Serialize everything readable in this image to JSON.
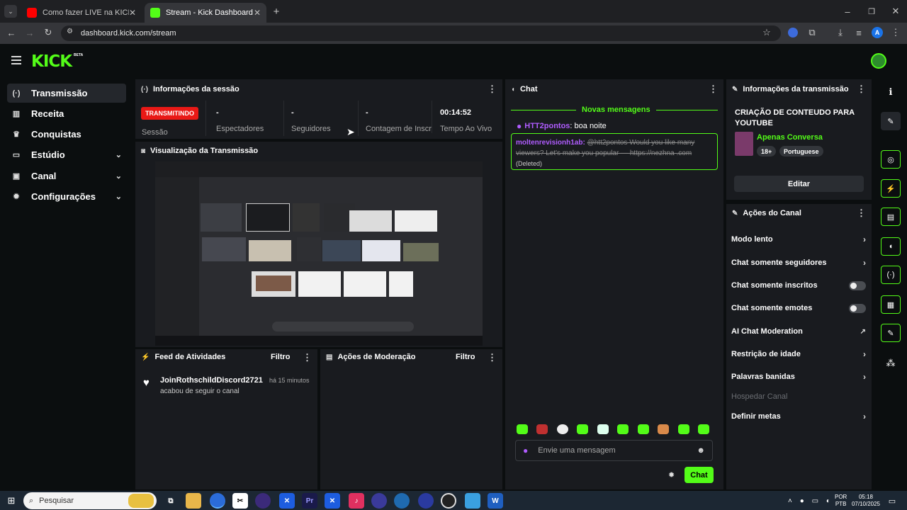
{
  "browser": {
    "tabs": [
      {
        "title": "Como fazer LIVE na KICK pelo C",
        "active": false
      },
      {
        "title": "Stream - Kick Dashboard",
        "active": true
      }
    ],
    "url": "dashboard.kick.com/stream",
    "profile_initial": "A"
  },
  "header": {
    "logo": "KICK",
    "beta": "BETA"
  },
  "sidebar": {
    "items": [
      {
        "label": "Transmissão",
        "icon": "broadcast-icon",
        "active": true
      },
      {
        "label": "Receita",
        "icon": "chart-icon"
      },
      {
        "label": "Conquistas",
        "icon": "trophy-icon"
      },
      {
        "label": "Estúdio",
        "icon": "monitor-icon",
        "expand": true
      },
      {
        "label": "Canal",
        "icon": "user-icon",
        "expand": true
      },
      {
        "label": "Configurações",
        "icon": "gear-icon",
        "expand": true
      }
    ]
  },
  "session": {
    "title": "Informações da sessão",
    "badge": "TRANSMITINDO",
    "session_label": "Sessão",
    "stats": [
      {
        "value": "-",
        "label": "Espectadores"
      },
      {
        "value": "-",
        "label": "Seguidores"
      },
      {
        "value": "-",
        "label": "Contagem de Inscritos"
      },
      {
        "value": "00:14:52",
        "label": "Tempo Ao Vivo"
      }
    ]
  },
  "preview": {
    "title": "Visualização da Transmissão"
  },
  "activity": {
    "title": "Feed de Atividades",
    "filter": "Filtro",
    "items": [
      {
        "user": "JoinRothschildDiscord2721",
        "time": "há 15 minutos",
        "text": "acabou de seguir o canal"
      }
    ]
  },
  "moderation": {
    "title": "Ações de Moderação",
    "filter": "Filtro"
  },
  "chat": {
    "title": "Chat",
    "new_messages": "Novas mensagens",
    "messages": [
      {
        "user": "HTT2pontos",
        "text": ": boa noite"
      },
      {
        "user": "moltenrevisionh1ab:",
        "text": "@htt2pontos Would you like many viewers? Let's make you popular — https://nezhna .com",
        "deleted": "(Deleted)"
      }
    ],
    "placeholder": "Envie uma mensagem",
    "send": "Chat"
  },
  "stream_info": {
    "title": "Informações da transmissão",
    "stream_title": "CRIAÇÃO DE CONTEUDO PARA YOUTUBE",
    "category": "Apenas Conversa",
    "tags": [
      "18+",
      "Portuguese"
    ],
    "edit": "Editar"
  },
  "channel_actions": {
    "title": "Ações do Canal",
    "items": [
      {
        "label": "Modo lento",
        "control": "arrow"
      },
      {
        "label": "Chat somente seguidores",
        "control": "arrow"
      },
      {
        "label": "Chat somente inscritos",
        "control": "toggle"
      },
      {
        "label": "Chat somente emotes",
        "control": "toggle"
      },
      {
        "label": "AI Chat Moderation",
        "control": "external"
      },
      {
        "label": "Restrição de idade",
        "control": "arrow"
      },
      {
        "label": "Palavras banidas",
        "control": "arrow"
      },
      {
        "label": "Hospedar Canal",
        "control": "none",
        "disabled": true
      },
      {
        "label": "Definir metas",
        "control": "arrow"
      }
    ]
  },
  "taskbar": {
    "search": "Pesquisar",
    "lang1": "POR",
    "lang2": "PTB",
    "time": "05:18",
    "date": "07/10/2025"
  },
  "colors": {
    "accent": "#53fc18",
    "badge": "#e91916",
    "username": "#b05cff"
  }
}
